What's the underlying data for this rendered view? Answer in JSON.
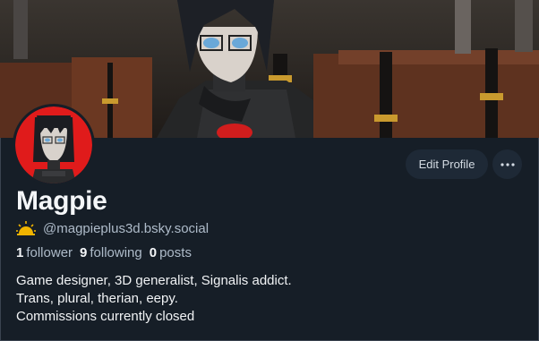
{
  "profile": {
    "display_name": "Magpie",
    "handle": "@magpieplus3d.bsky.social",
    "handle_icon": "sun-emoji-icon",
    "stats": {
      "followers_count": "1",
      "followers_label": "follower",
      "following_count": "9",
      "following_label": "following",
      "posts_count": "0",
      "posts_label": "posts"
    },
    "bio_lines": [
      "Game designer, 3D generalist, Signalis addict.",
      "Trans, plural, therian, eepy.",
      "Commissions currently closed"
    ]
  },
  "actions": {
    "edit_profile_label": "Edit Profile",
    "more_icon": "ellipsis-icon"
  },
  "colors": {
    "background": "#161e27",
    "button_bg": "#1e2936",
    "muted_text": "#aebbc9",
    "avatar_bg": "#e01b1b"
  }
}
